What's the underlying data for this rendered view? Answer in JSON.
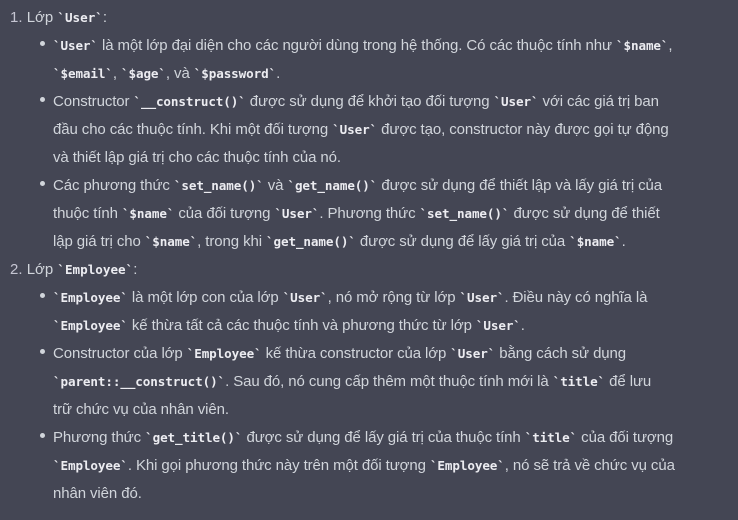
{
  "list": {
    "item1": {
      "marker": "1.",
      "title_pre": "Lớp ",
      "title_code": "`User`",
      "title_post": ":",
      "b1": {
        "l1": [
          {
            "t": "",
            "c": "`User`"
          },
          {
            "t": " là một lớp đại diện cho các người dùng trong hệ thống. Có các thuộc tính như ",
            "c": "`$name`"
          },
          {
            "t": ",",
            "c": ""
          }
        ],
        "l2": [
          {
            "t": "",
            "c": "`$email`"
          },
          {
            "t": ", ",
            "c": "`$age`"
          },
          {
            "t": ", và ",
            "c": "`$password`"
          },
          {
            "t": ".",
            "c": ""
          }
        ]
      },
      "b2": {
        "l1": [
          {
            "t": "Constructor ",
            "c": "`__construct()`"
          },
          {
            "t": " được sử dụng để khởi tạo đối tượng ",
            "c": "`User`"
          },
          {
            "t": " với các giá trị ban",
            "c": ""
          }
        ],
        "l2": [
          {
            "t": "đầu cho các thuộc tính. Khi một đối tượng ",
            "c": "`User`"
          },
          {
            "t": " được tạo, constructor này được gọi tự động",
            "c": ""
          }
        ],
        "l3": [
          {
            "t": "và thiết lập giá trị cho các thuộc tính của nó.",
            "c": ""
          }
        ]
      },
      "b3": {
        "l1": [
          {
            "t": "Các phương thức ",
            "c": "`set_name()`"
          },
          {
            "t": " và ",
            "c": "`get_name()`"
          },
          {
            "t": " được sử dụng để thiết lập và lấy giá trị của",
            "c": ""
          }
        ],
        "l2": [
          {
            "t": "thuộc tính ",
            "c": "`$name`"
          },
          {
            "t": " của đối tượng ",
            "c": "`User`"
          },
          {
            "t": ". Phương thức ",
            "c": "`set_name()`"
          },
          {
            "t": " được sử dụng để thiết",
            "c": ""
          }
        ],
        "l3": [
          {
            "t": "lập giá trị cho ",
            "c": "`$name`"
          },
          {
            "t": ", trong khi ",
            "c": "`get_name()`"
          },
          {
            "t": " được sử dụng để lấy giá trị của ",
            "c": "`$name`"
          },
          {
            "t": ".",
            "c": ""
          }
        ]
      }
    },
    "item2": {
      "marker": "2.",
      "title_pre": "Lớp ",
      "title_code": "`Employee`",
      "title_post": ":",
      "b1": {
        "l1": [
          {
            "t": "",
            "c": "`Employee`"
          },
          {
            "t": " là một lớp con của lớp ",
            "c": "`User`"
          },
          {
            "t": ", nó mở rộng từ lớp ",
            "c": "`User`"
          },
          {
            "t": ". Điều này có nghĩa là",
            "c": ""
          }
        ],
        "l2": [
          {
            "t": "",
            "c": "`Employee`"
          },
          {
            "t": " kế thừa tất cả các thuộc tính và phương thức từ lớp ",
            "c": "`User`"
          },
          {
            "t": ".",
            "c": ""
          }
        ]
      },
      "b2": {
        "l1": [
          {
            "t": "Constructor của lớp ",
            "c": "`Employee`"
          },
          {
            "t": " kế thừa constructor của lớp ",
            "c": "`User`"
          },
          {
            "t": " bằng cách sử dụng",
            "c": ""
          }
        ],
        "l2": [
          {
            "t": "",
            "c": "`parent::__construct()`"
          },
          {
            "t": ". Sau đó, nó cung cấp thêm một thuộc tính mới là ",
            "c": "`title`"
          },
          {
            "t": " để lưu",
            "c": ""
          }
        ],
        "l3": [
          {
            "t": "trữ chức vụ của nhân viên.",
            "c": ""
          }
        ]
      },
      "b3": {
        "l1": [
          {
            "t": "Phương thức ",
            "c": "`get_title()`"
          },
          {
            "t": " được sử dụng để lấy giá trị của thuộc tính ",
            "c": "`title`"
          },
          {
            "t": " của đối tượng",
            "c": ""
          }
        ],
        "l2": [
          {
            "t": "",
            "c": "`Employee`"
          },
          {
            "t": ". Khi gọi phương thức này trên một đối tượng ",
            "c": "`Employee`"
          },
          {
            "t": ", nó sẽ trả về chức vụ của",
            "c": ""
          }
        ],
        "l3": [
          {
            "t": "nhân viên đó.",
            "c": ""
          }
        ]
      }
    }
  }
}
